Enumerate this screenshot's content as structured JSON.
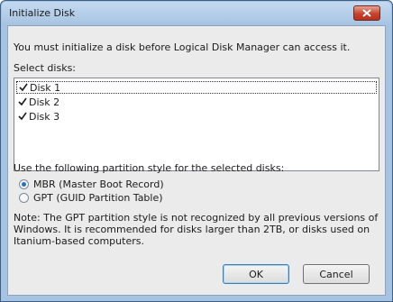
{
  "window": {
    "title": "Initialize Disk"
  },
  "intro_text": "You must initialize a disk before Logical Disk Manager can access it.",
  "select_disks_label": "Select disks:",
  "disks": [
    {
      "label": "Disk 1",
      "checked": true
    },
    {
      "label": "Disk 2",
      "checked": true
    },
    {
      "label": "Disk 3",
      "checked": true
    }
  ],
  "partition_style_label": "Use the following partition style for the selected disks:",
  "partition_options": [
    {
      "label": "MBR (Master Boot Record)",
      "selected": true
    },
    {
      "label": "GPT (GUID Partition Table)",
      "selected": false
    }
  ],
  "note": "Note: The GPT partition style is not recognized by all previous versions of Windows. It is recommended for disks larger than 2TB, or disks used on Itanium-based computers.",
  "buttons": {
    "ok_label": "OK",
    "cancel_label": "Cancel"
  },
  "colors": {
    "title_bar": "#a7c3e2",
    "close_button": "#c7432e",
    "dialog_background": "#ebebeb"
  },
  "icons": {
    "close": "close-icon",
    "checkbox": "checkmark-icon"
  }
}
